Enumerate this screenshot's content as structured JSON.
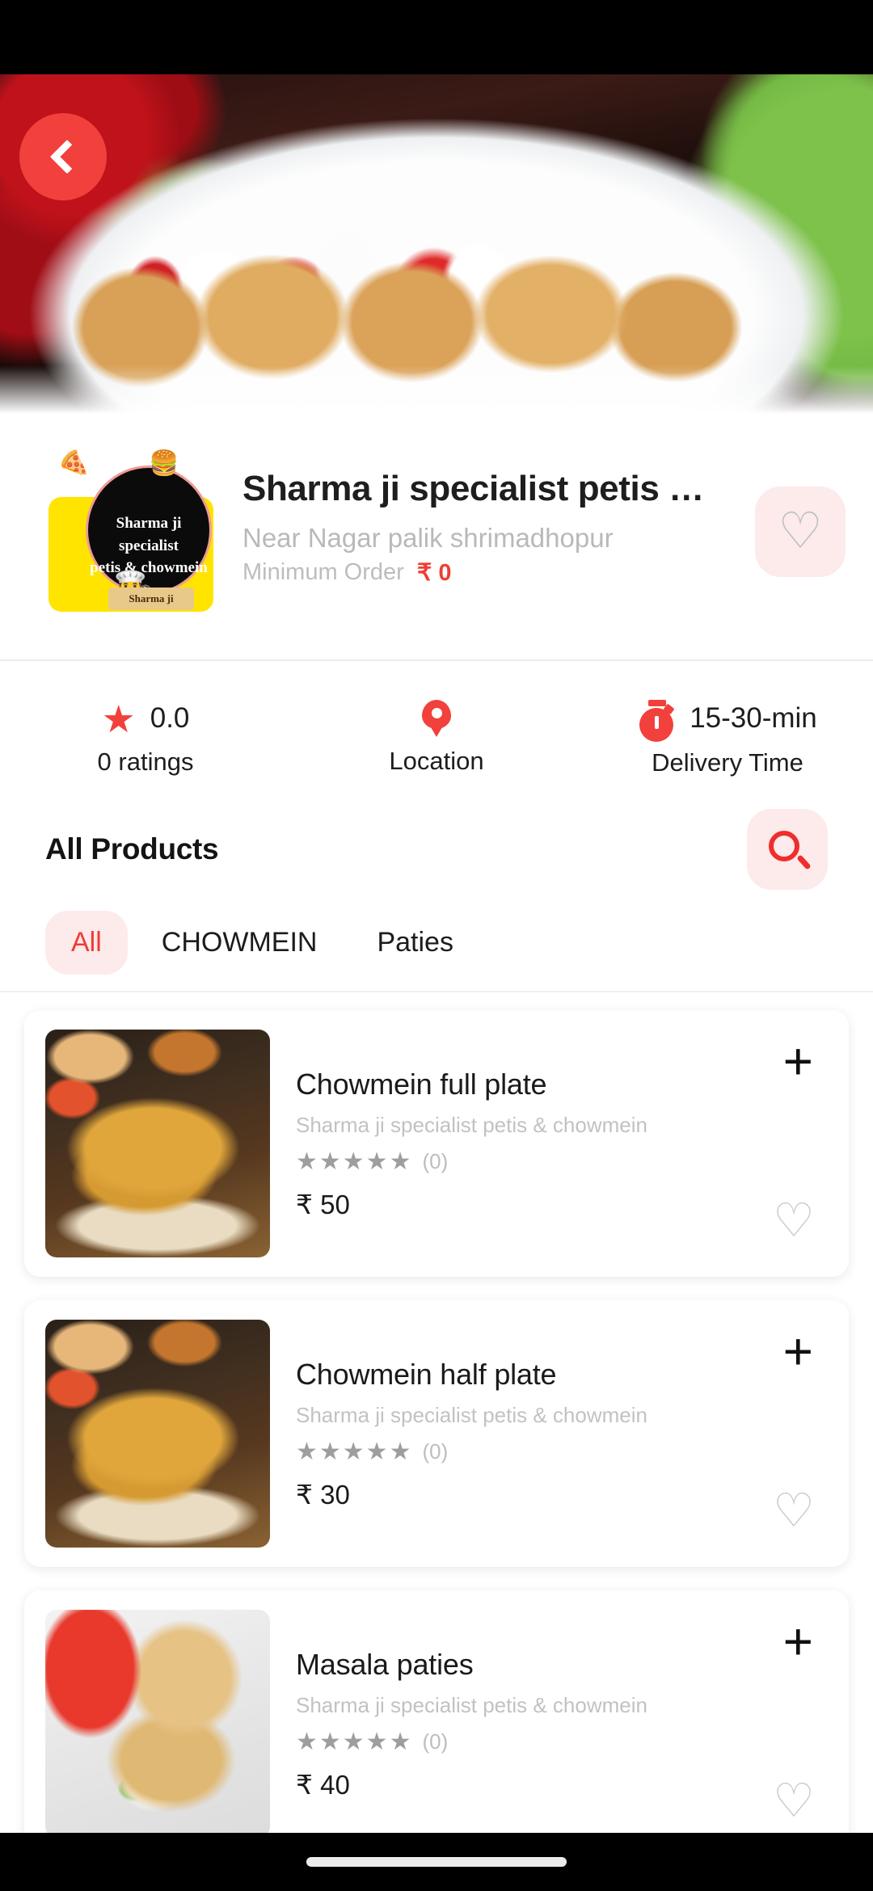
{
  "header": {
    "back_icon": "chevron-left-icon"
  },
  "restaurant": {
    "name": "Sharma ji specialist petis …",
    "address": "Near Nagar palik shrimadhopur",
    "minimum_order_label": "Minimum Order",
    "minimum_order_value": "₹ 0",
    "favorite_icon": "heart-outline-icon",
    "logo": {
      "line1": "Sharma ji specialist",
      "line2": "petis & chowmein",
      "ribbon": "Sharma ji",
      "pizza_icon": "pizza-icon",
      "burger_icon": "burger-icon",
      "chef_icon": "chef-icon"
    }
  },
  "stats": [
    {
      "icon": "star-icon",
      "value": "0.0",
      "label": "0 ratings"
    },
    {
      "icon": "location-pin-icon",
      "value": "",
      "label": "Location"
    },
    {
      "icon": "timer-icon",
      "value": "15-30-min",
      "label": "Delivery Time"
    }
  ],
  "section": {
    "title": "All Products",
    "search_icon": "search-icon"
  },
  "tabs": [
    {
      "label": "All",
      "active": true
    },
    {
      "label": "CHOWMEIN",
      "active": false
    },
    {
      "label": "Paties",
      "active": false
    }
  ],
  "products": [
    {
      "name": "Chowmein full plate",
      "shop": "Sharma ji specialist petis & chowmein",
      "stars": "★★★★★",
      "rating_count": "(0)",
      "price": "₹ 50",
      "add_icon": "plus-icon",
      "favorite_icon": "heart-outline-icon",
      "thumb": "noodle"
    },
    {
      "name": "Chowmein half plate",
      "shop": "Sharma ji specialist petis & chowmein",
      "stars": "★★★★★",
      "rating_count": "(0)",
      "price": "₹ 30",
      "add_icon": "plus-icon",
      "favorite_icon": "heart-outline-icon",
      "thumb": "noodle"
    },
    {
      "name": "Masala paties",
      "shop": "Sharma ji specialist petis & chowmein",
      "stars": "★★★★★",
      "rating_count": "(0)",
      "price": "₹ 40",
      "add_icon": "plus-icon",
      "favorite_icon": "heart-outline-icon",
      "thumb": "patty"
    }
  ],
  "colors": {
    "accent_red": "#f2403c",
    "accent_soft": "#fdeaea",
    "text_dark": "#1a1a1a",
    "text_muted": "#bdbdbd"
  },
  "navbar": {
    "home_indicator": "home-indicator"
  }
}
